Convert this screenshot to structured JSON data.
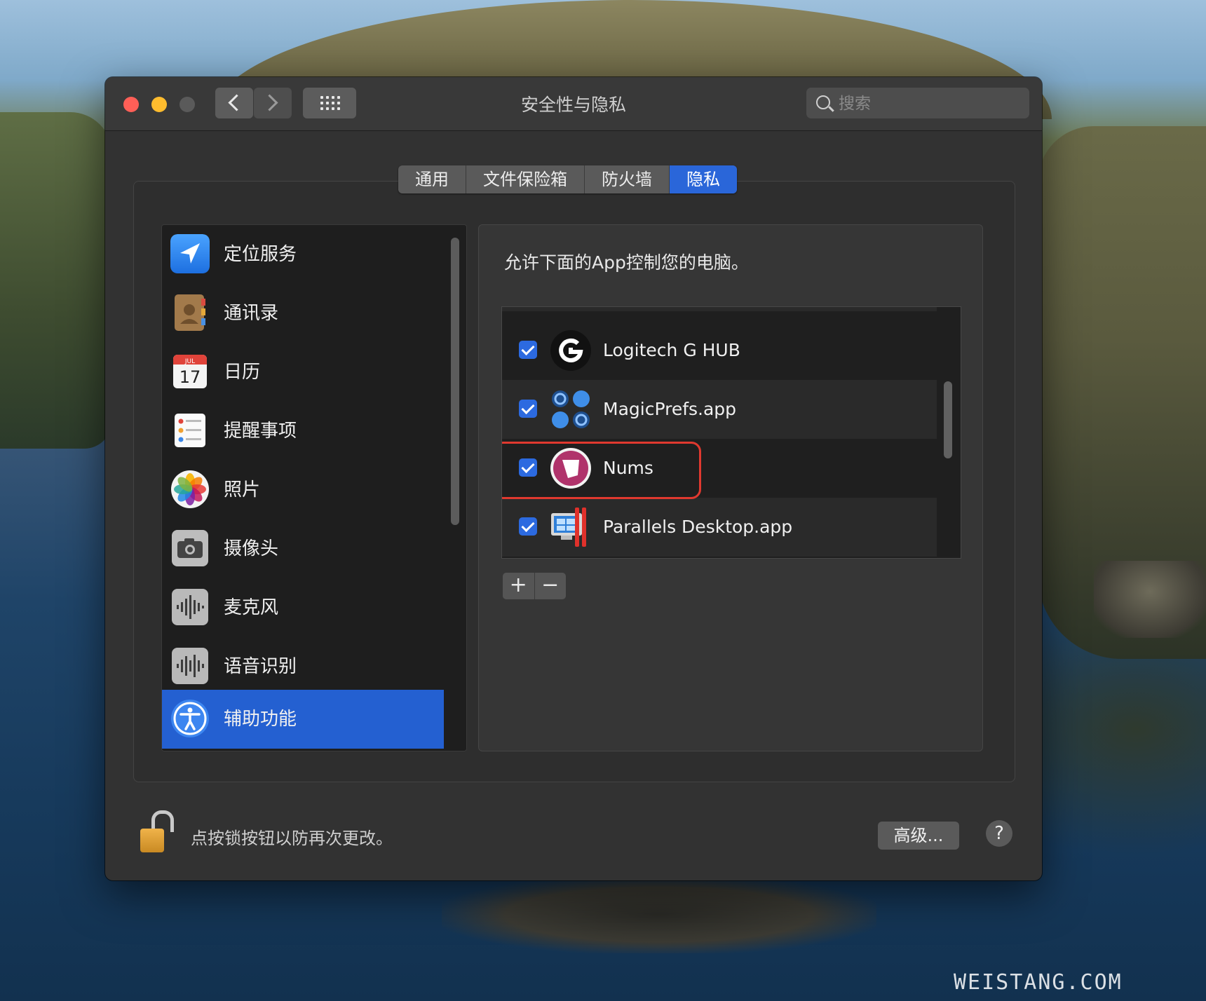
{
  "window": {
    "title": "安全性与隐私"
  },
  "search": {
    "placeholder": "搜索"
  },
  "tabs": [
    {
      "label": "通用",
      "active": false
    },
    {
      "label": "文件保险箱",
      "active": false
    },
    {
      "label": "防火墙",
      "active": false
    },
    {
      "label": "隐私",
      "active": true
    }
  ],
  "sidebar": {
    "items": [
      {
        "label": "定位服务",
        "icon": "location-arrow-icon"
      },
      {
        "label": "通讯录",
        "icon": "contacts-book-icon"
      },
      {
        "label": "日历",
        "icon": "calendar-icon",
        "month": "JUL",
        "day": "17"
      },
      {
        "label": "提醒事项",
        "icon": "reminders-list-icon"
      },
      {
        "label": "照片",
        "icon": "photos-flower-icon"
      },
      {
        "label": "摄像头",
        "icon": "camera-icon"
      },
      {
        "label": "麦克风",
        "icon": "microphone-waveform-icon"
      },
      {
        "label": "语音识别",
        "icon": "speech-waveform-icon"
      },
      {
        "label": "辅助功能",
        "icon": "accessibility-icon",
        "selected": true
      }
    ]
  },
  "right": {
    "title": "允许下面的App控制您的电脑。",
    "apps": [
      {
        "name": "Logitech G HUB",
        "checked": true,
        "icon": "logitech-g-icon"
      },
      {
        "name": "MagicPrefs.app",
        "checked": true,
        "icon": "magicprefs-icon"
      },
      {
        "name": "Nums",
        "checked": true,
        "icon": "nums-icon"
      },
      {
        "name": "Parallels Desktop.app",
        "checked": true,
        "icon": "parallels-icon"
      }
    ],
    "add_label": "+",
    "remove_label": "−"
  },
  "footer": {
    "lock_text": "点按锁按钮以防再次更改。",
    "advanced_label": "高级...",
    "help_label": "?"
  },
  "watermark": "WEISTANG.COM",
  "colors": {
    "accent": "#2a66d9",
    "highlight": "#e0392f",
    "window_bg": "#323232"
  }
}
